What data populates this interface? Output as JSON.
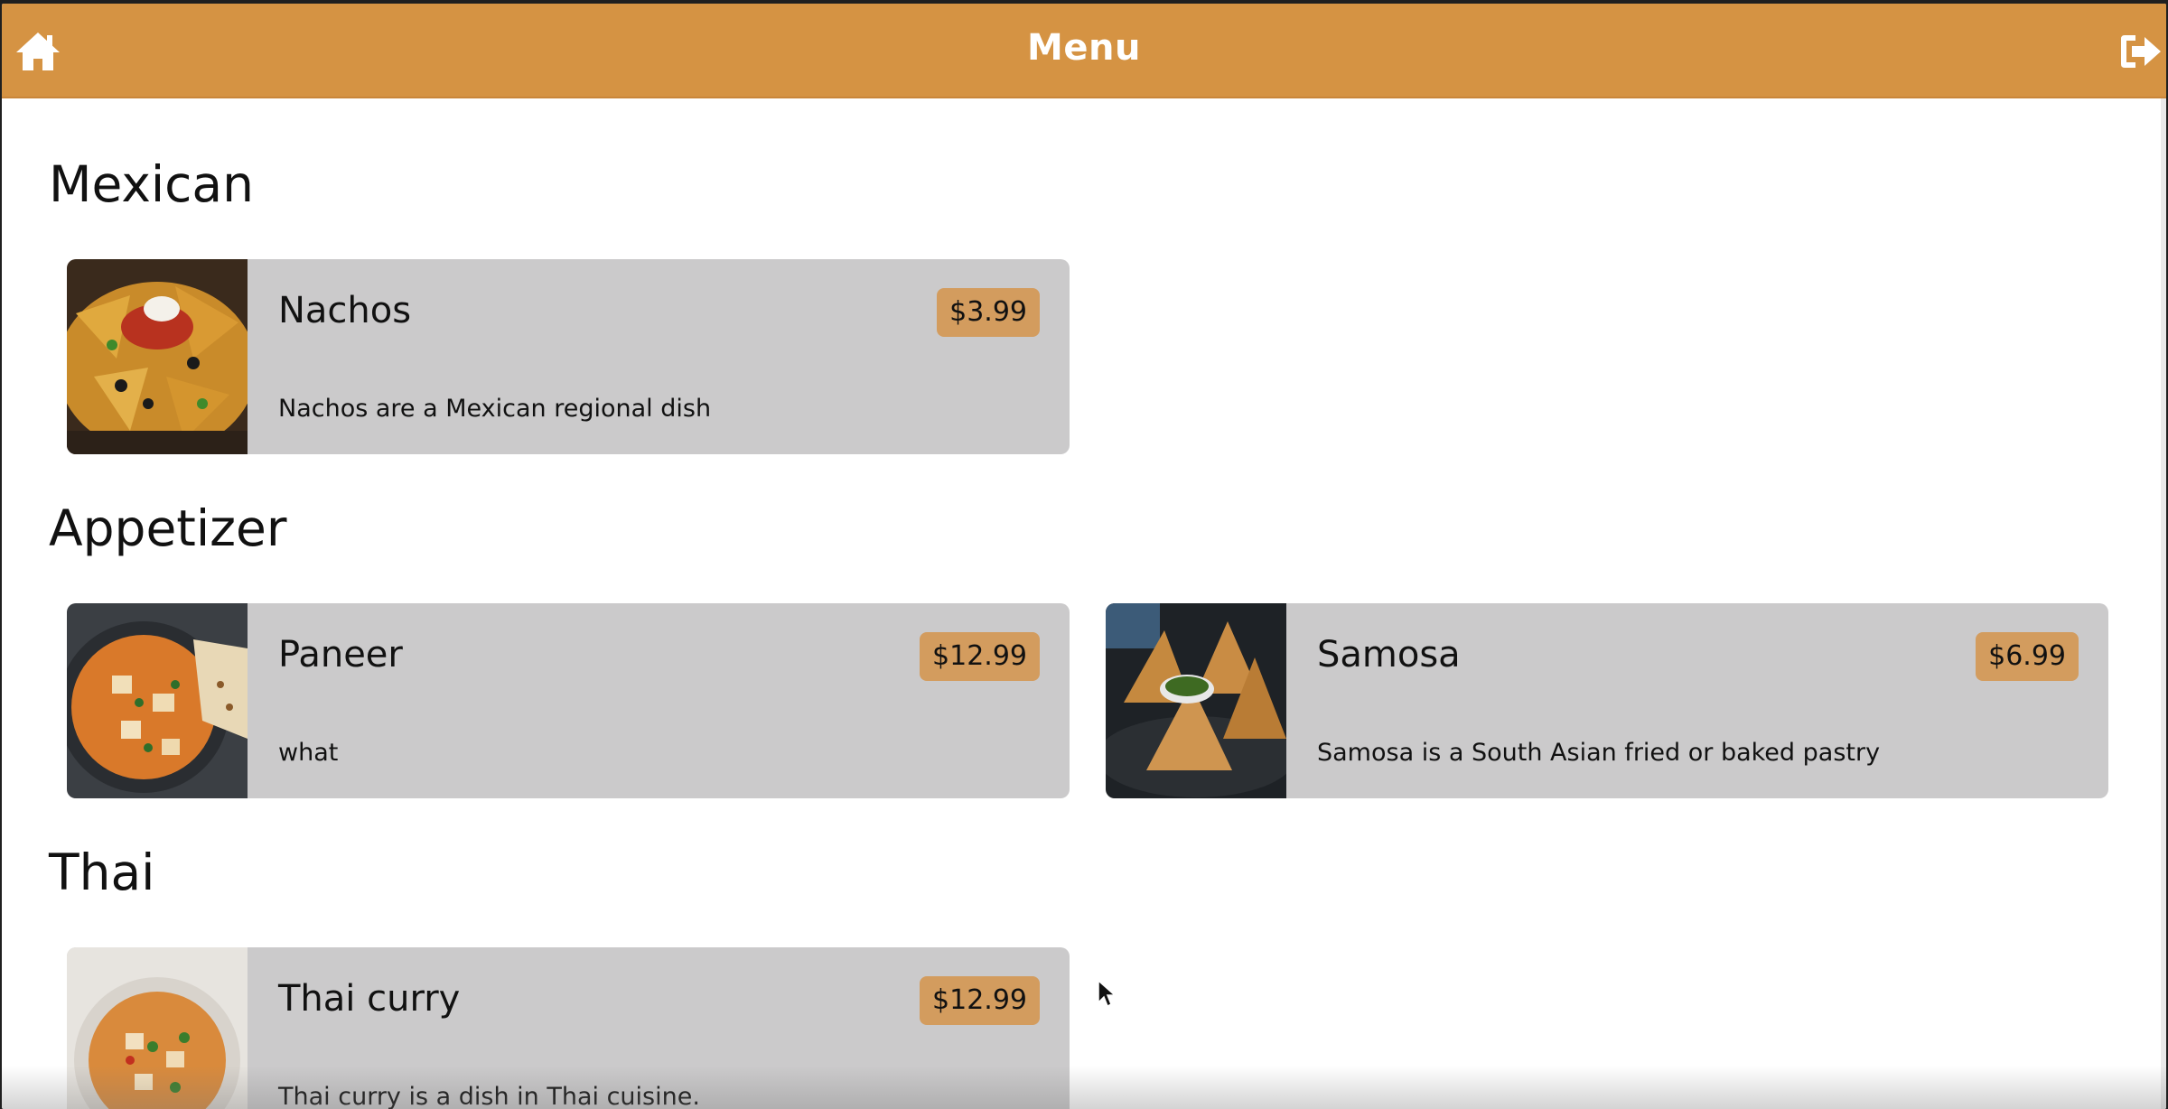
{
  "header": {
    "title": "Menu",
    "home_icon": "home-icon",
    "logout_icon": "sign-out-icon",
    "bar_color": "#d59343"
  },
  "sections": [
    {
      "title": "Mexican",
      "items": [
        {
          "name": "Nachos",
          "price": "$3.99",
          "description": "Nachos are a Mexican regional dish",
          "image": "nachos-photo"
        }
      ]
    },
    {
      "title": "Appetizer",
      "items": [
        {
          "name": "Paneer",
          "price": "$12.99",
          "description": "what",
          "image": "paneer-curry-photo"
        },
        {
          "name": "Samosa",
          "price": "$6.99",
          "description": "Samosa is a South Asian fried or baked pastry",
          "image": "samosa-photo"
        }
      ]
    },
    {
      "title": "Thai",
      "items": [
        {
          "name": "Thai curry",
          "price": "$12.99",
          "description": "Thai curry is a dish in Thai cuisine.",
          "image": "thai-curry-photo"
        }
      ]
    }
  ],
  "colors": {
    "card_background": "#cbcacb",
    "price_badge": "#d39c5e"
  }
}
